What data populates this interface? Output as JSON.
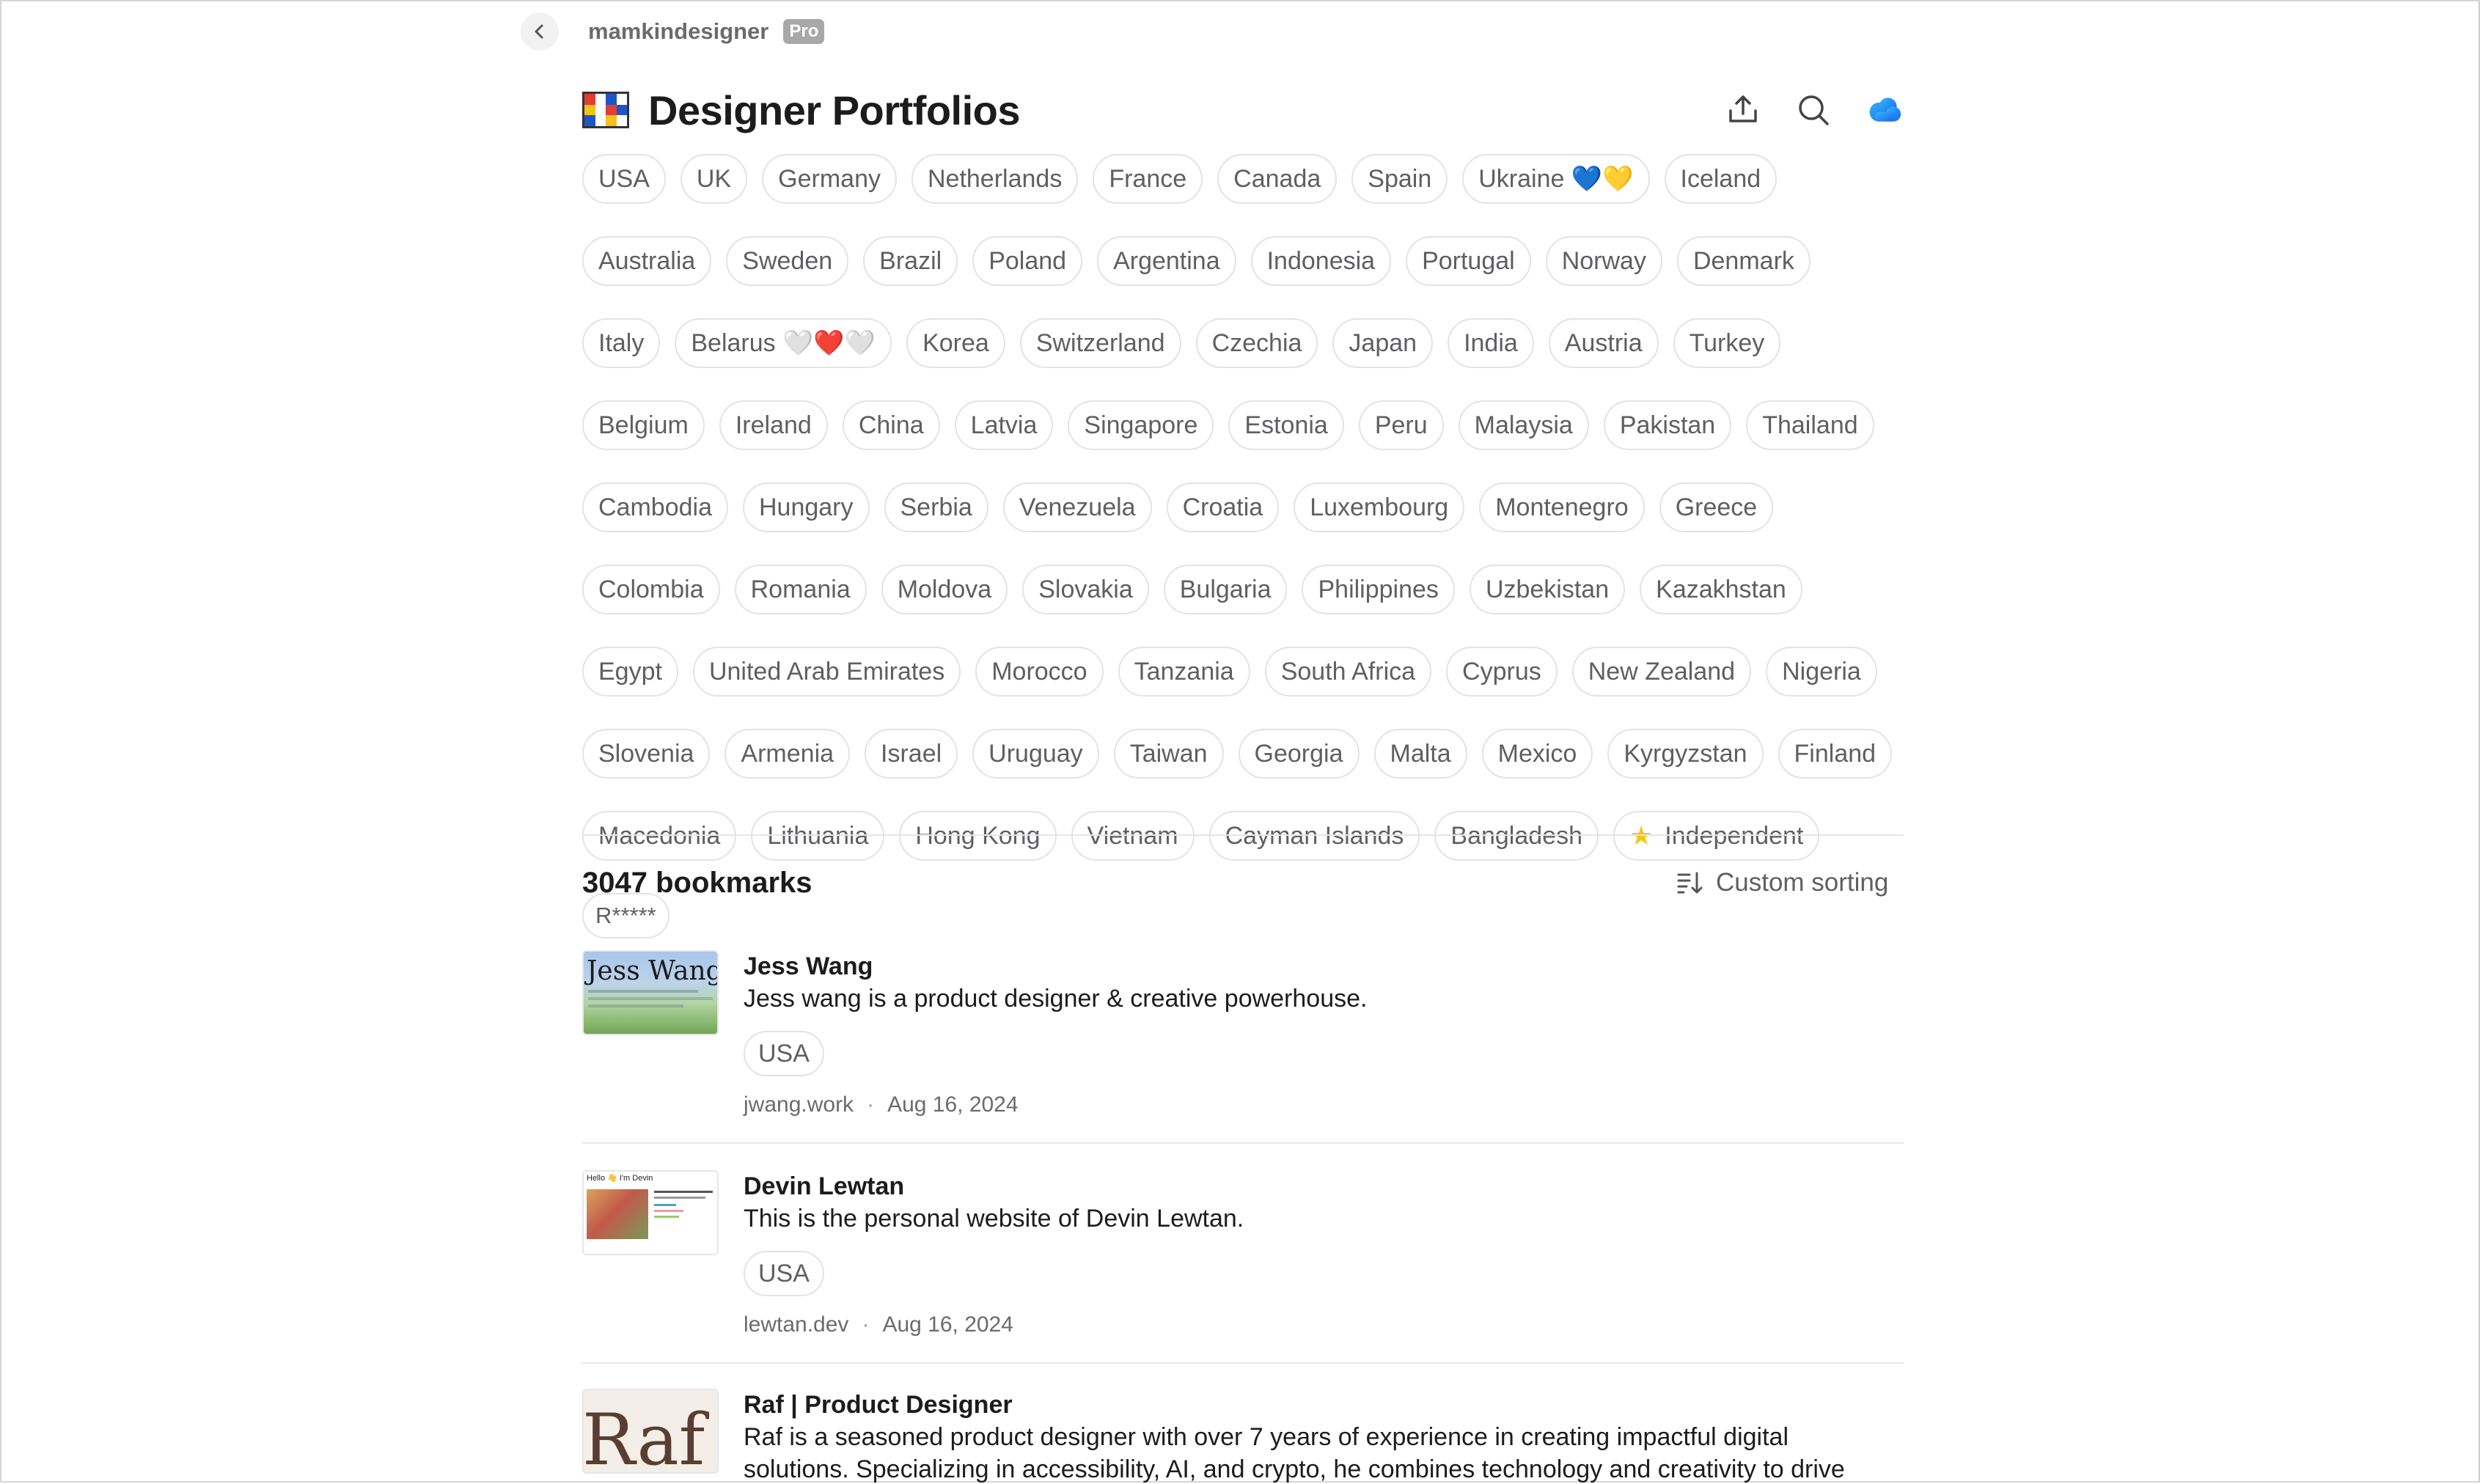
{
  "header": {
    "username": "mamkindesigner",
    "badge": "Pro"
  },
  "page": {
    "title": "Designer Portfolios"
  },
  "collections": [
    [
      "USA",
      "UK",
      "Germany",
      "Netherlands",
      "France",
      "Canada",
      "Spain",
      "Ukraine 💙💛",
      "Iceland"
    ],
    [
      "Australia",
      "Sweden",
      "Brazil",
      "Poland",
      "Argentina",
      "Indonesia",
      "Portugal",
      "Norway",
      "Denmark"
    ],
    [
      "Italy",
      "Belarus 🤍❤️🤍",
      "Korea",
      "Switzerland",
      "Czechia",
      "Japan",
      "India",
      "Austria",
      "Turkey"
    ],
    [
      "Belgium",
      "Ireland",
      "China",
      "Latvia",
      "Singapore",
      "Estonia",
      "Peru",
      "Malaysia",
      "Pakistan",
      "Thailand"
    ],
    [
      "Cambodia",
      "Hungary",
      "Serbia",
      "Venezuela",
      "Croatia",
      "Luxembourg",
      "Montenegro",
      "Greece"
    ],
    [
      "Colombia",
      "Romania",
      "Moldova",
      "Slovakia",
      "Bulgaria",
      "Philippines",
      "Uzbekistan",
      "Kazakhstan"
    ],
    [
      "Egypt",
      "United Arab Emirates",
      "Morocco",
      "Tanzania",
      "South Africa",
      "Cyprus",
      "New Zealand",
      "Nigeria"
    ],
    [
      "Slovenia",
      "Armenia",
      "Israel",
      "Uruguay",
      "Taiwan",
      "Georgia",
      "Malta",
      "Mexico",
      "Kyrgyzstan",
      "Finland"
    ],
    [
      "Macedonia",
      "Lithuania",
      "Hong Kong",
      "Vietnam",
      "Cayman Islands",
      "Bangladesh",
      "Independent"
    ],
    [
      "R*****"
    ]
  ],
  "list": {
    "count_label": "3047 bookmarks",
    "sort_label": "Custom sorting"
  },
  "bookmarks": [
    {
      "title": "Jess Wang",
      "description": "Jess wang is a product designer & creative powerhouse.",
      "tag": "USA",
      "domain": "jwang.work",
      "date": "Aug 16, 2024",
      "thumb_text": "Jess Wang"
    },
    {
      "title": "Devin Lewtan",
      "description": "This is the personal website of Devin Lewtan.",
      "tag": "USA",
      "domain": "lewtan.dev",
      "date": "Aug 16, 2024",
      "thumb_text": "Hello 👋 I'm Devin"
    },
    {
      "title": "Raf | Product Designer",
      "description": "Raf is a seasoned product designer with over 7 years of experience in creating impactful digital solutions. Specializing in accessibility, AI, and crypto, he combines technology and creativity to drive",
      "thumb_text": "Raf"
    }
  ],
  "colors": {
    "accent_cloud": "#1e8cf5",
    "star": "#f5c518"
  }
}
